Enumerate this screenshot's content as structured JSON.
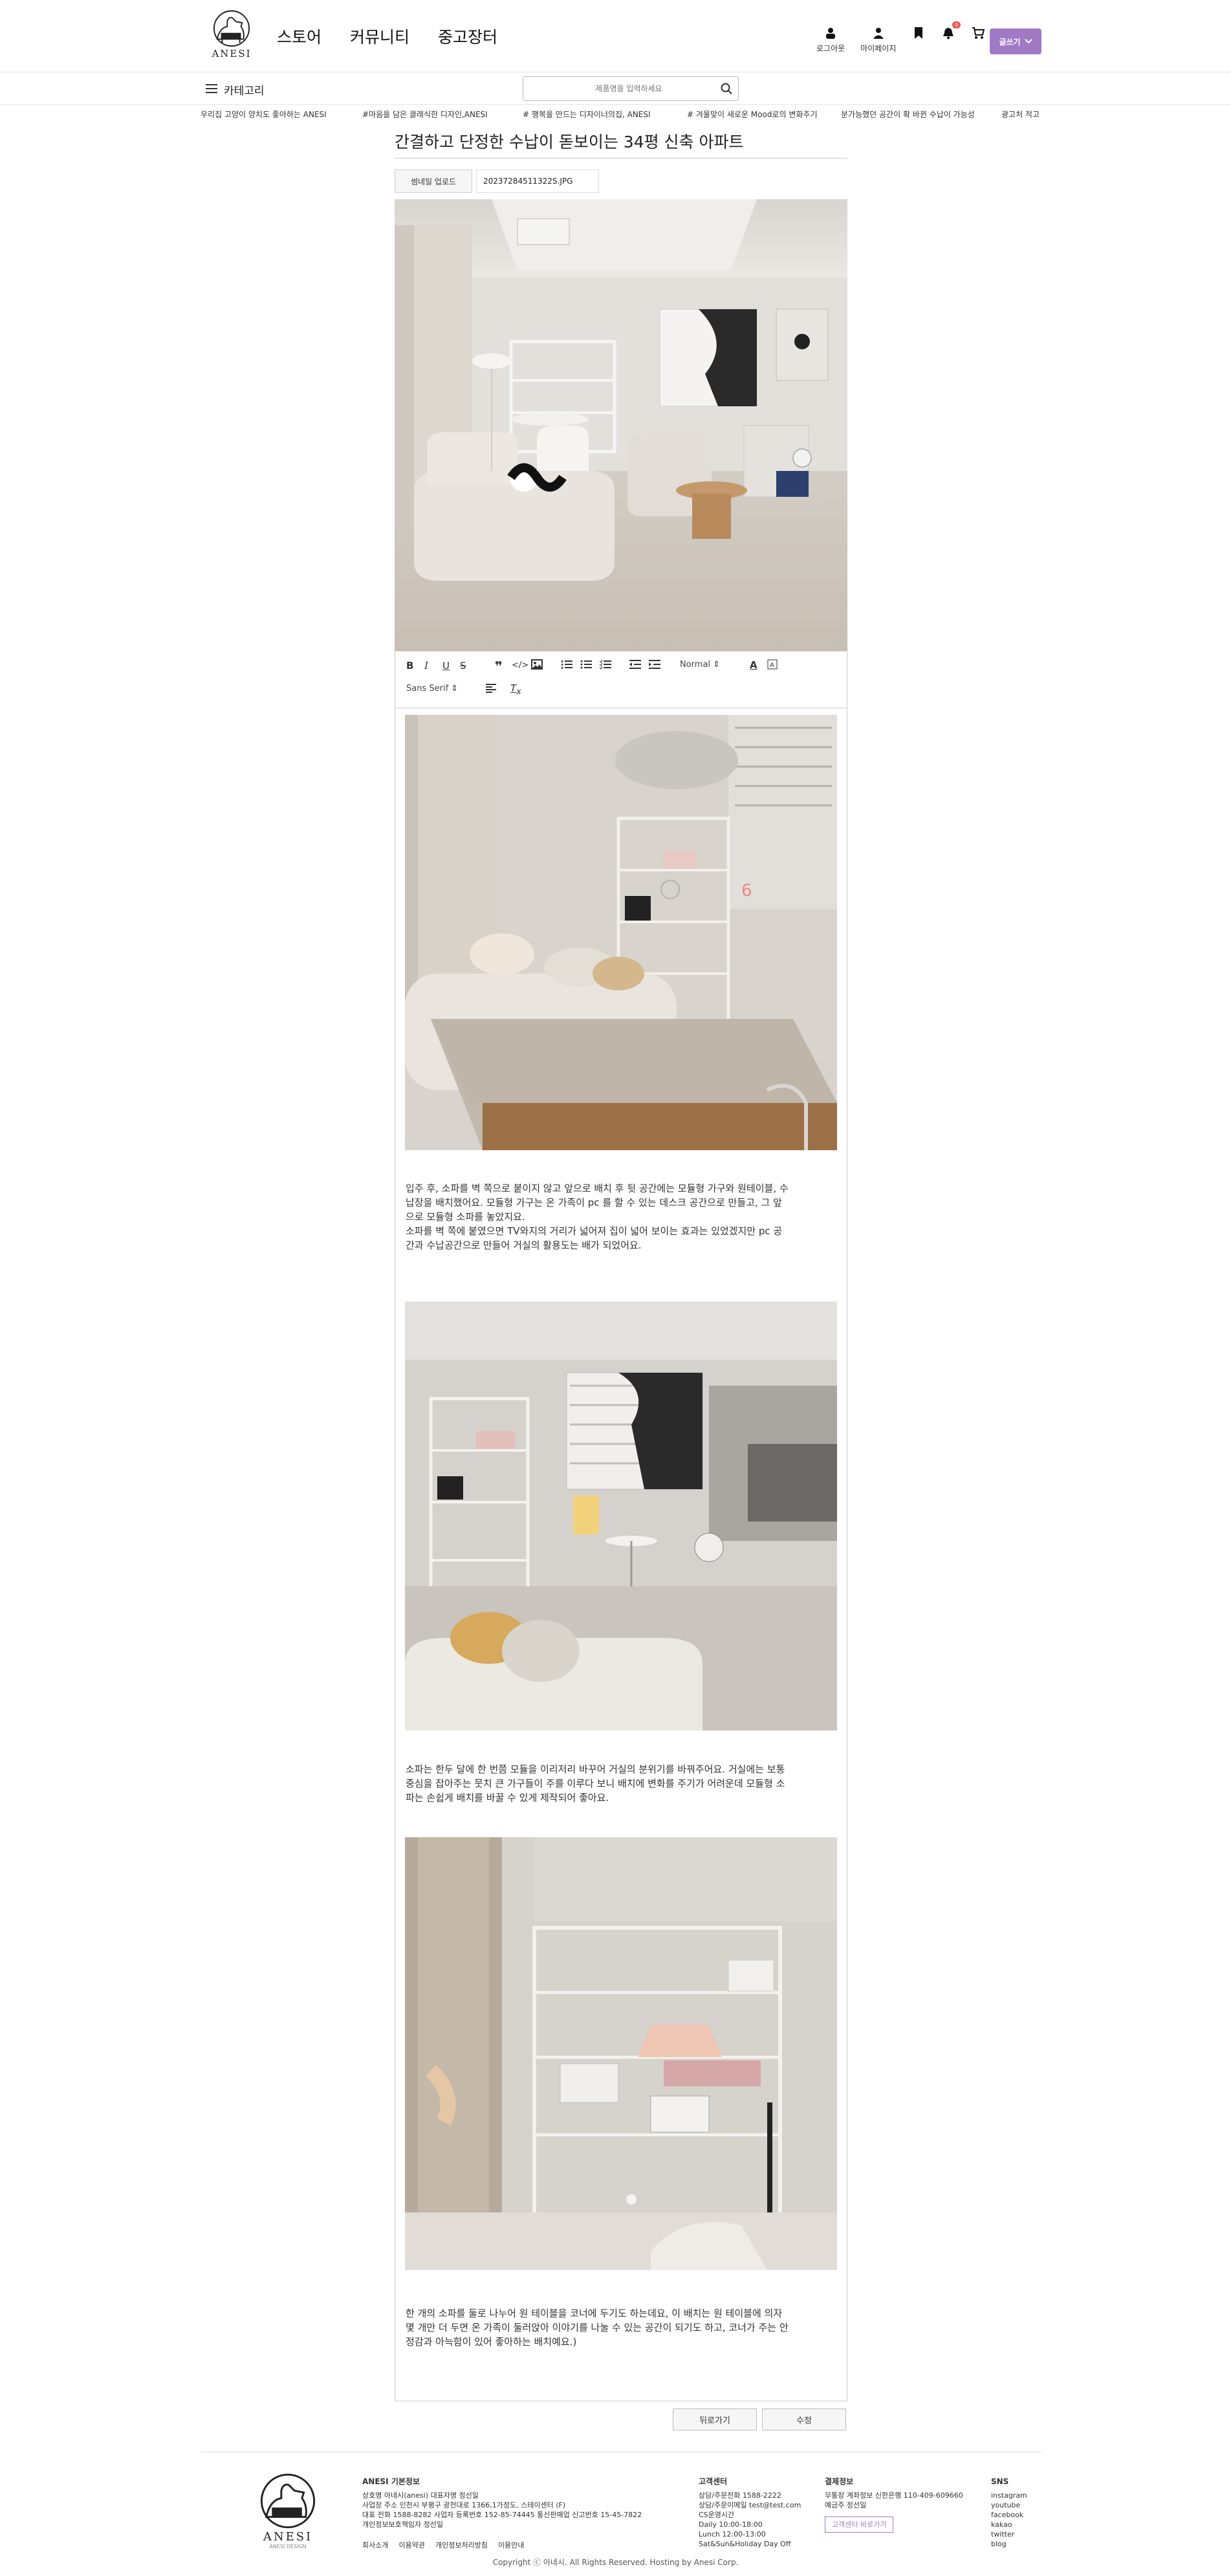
{
  "header": {
    "logo_text": "ANESI",
    "nav": [
      "스토어",
      "커뮤니티",
      "중고장터"
    ],
    "util": [
      {
        "icon": "logout-icon",
        "label": "로그아웃"
      },
      {
        "icon": "user-icon",
        "label": "마이페이지"
      },
      {
        "icon": "bookmark-icon",
        "label": ""
      },
      {
        "icon": "bell-icon",
        "label": "",
        "badge": "0"
      },
      {
        "icon": "cart-icon",
        "label": ""
      }
    ],
    "write_button": "글쓰기",
    "accent": "#a17ac6"
  },
  "subbar": {
    "category_label": "카테고리",
    "search_placeholder": "제품명을 입력하세요"
  },
  "ticker": [
    "우리집 고양이 양치도 좋아하는 ANESI",
    "#마음을 담은 클래식한 디자인,ANESI",
    "# 행복을 만드는 디자이너의집, ANESI",
    "# 겨울맞이 새로운 Mood로의 변화주기",
    "분가능했던 공간이 확 바뀐 수납이 가능성",
    "광고처 적고"
  ],
  "post": {
    "title": "간결하고 단정한 수납이 돋보이는 34평 신축 아파트",
    "thumb_button": "썸네일 업로드",
    "thumb_filename": "20237284511322S.JPG"
  },
  "toolbar": {
    "header_select": "Normal",
    "font_select": "Sans Serif"
  },
  "paragraphs": {
    "p1": [
      "입주 후, 소파를 벽 쪽으로 붙이지 않고 앞으로 배치 후 뒷 공간에는 모듈형 가구와 원테이블, 수",
      "납장을 배치했어요. 모듈형 가구는 온 가족이 pc 를 할 수 있는 데스크 공간으로 만들고, 그 앞",
      "으로 모듈형 소파를 놓았지요.",
      "소파를 벽 쪽에 붙였으면 TV와지의 거리가 넓어져 집이 넓어 보이는 효과는 있었겠지만 pc 공",
      "간과 수납공간으로 만들어 거실의 활용도는 배가 되었어요."
    ],
    "p2": [
      "소파는 한두 달에 한 번쯤 모듈을 이리저리 바꾸어 거실의 분위기를 바꿔주어요. 거실에는 보통",
      "중심을 잡아주는 뭇치 큰 가구들이 주를 이루다 보니 배치에 변화를 주기가 어려운데 모듈형 소",
      "파는 손쉽게 배치를 바꿀 수 있게 제작되어 좋아요."
    ],
    "p3": [
      "한 개의 소파를 둘로 나누어 원 테이블을 코너에 두기도 하는데요, 이 배치는 원 테이블에 의자",
      "몇 개만 더 두면 온 가족이 둘러앉아 이야기를 나눌 수 있는 공간이 되기도 하고, 코너가 주는 안",
      "정감과 아늑함이 있어 좋아하는 배치예요.)"
    ]
  },
  "actions": {
    "back": "뒤로가기",
    "edit": "수정"
  },
  "footer": {
    "company_heading": "ANESI 기본정보",
    "company_lines": [
      "상호명 아네시(anesi) 대표자명 정선일",
      "사업장 주소 인천시 부평구 광천대로 1366,1가정도, 스테이센터 (F)",
      "대표 전화 1588-8282 사업자 등록번호 152-85-74445 통신판매업 신고번호 15-45-7822",
      "개인정보보호책임자 정선일"
    ],
    "links": [
      "회사소개",
      "이용약관",
      "개인정보처리방침",
      "이용안내"
    ],
    "cs_heading": "고객센터",
    "cs_lines": [
      "상담/주문전화 1588-2222",
      "상담/주문이메일 test@test.com",
      "CS운영시간",
      "Daily 10:00-18:00",
      "Lunch 12:00-13:00",
      "Sat&Sun&Holiday Day Off"
    ],
    "pay_heading": "결제정보",
    "pay_lines": [
      "무통장 계좌정보 신한은행 110-409-609660",
      "예금주 정선일"
    ],
    "chat_button": "고객센터 바로가기",
    "sns_heading": "SNS",
    "sns": [
      "instagram",
      "youtube",
      "facebook",
      "kakao",
      "twitter",
      "blog"
    ],
    "logo_text": "ANESI",
    "logo_sub": "ANESI DESIGN",
    "copyright": "Copyright ⓒ 아네시. All Rights Reserved. Hosting by Anesi Corp."
  }
}
